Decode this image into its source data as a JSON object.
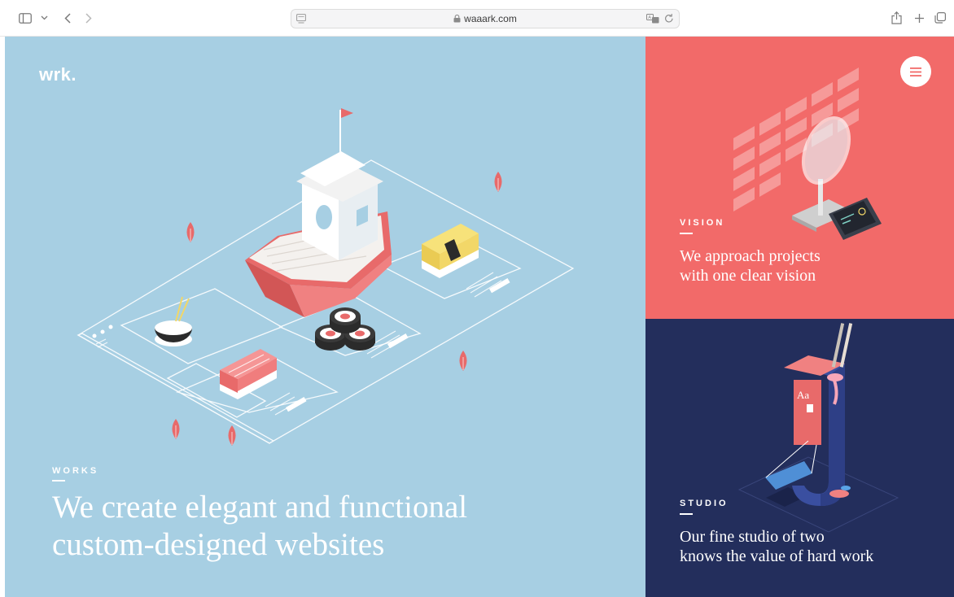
{
  "browser": {
    "url": "waaark.com",
    "icons": [
      "sidebar-icon",
      "chevron-down-icon",
      "back-icon",
      "forward-icon",
      "reader-icon",
      "lock-icon",
      "translate-icon",
      "reload-icon",
      "share-icon",
      "new-tab-icon",
      "tabs-overview-icon"
    ]
  },
  "site": {
    "logo": "wrk.",
    "menu_icon": "hamburger-icon"
  },
  "works": {
    "label": "WORKS",
    "headline_line1": "We create elegant and functional",
    "headline_line2": "custom-designed websites",
    "bg": "#a7cfe3"
  },
  "vision": {
    "label": "VISION",
    "headline_line1": "We approach projects",
    "headline_line2": "with one clear vision",
    "bg": "#f26a69"
  },
  "studio": {
    "label": "STUDIO",
    "headline_line1": "Our fine studio of two",
    "headline_line2": "knows the value of hard work",
    "bg": "#232e5c"
  }
}
